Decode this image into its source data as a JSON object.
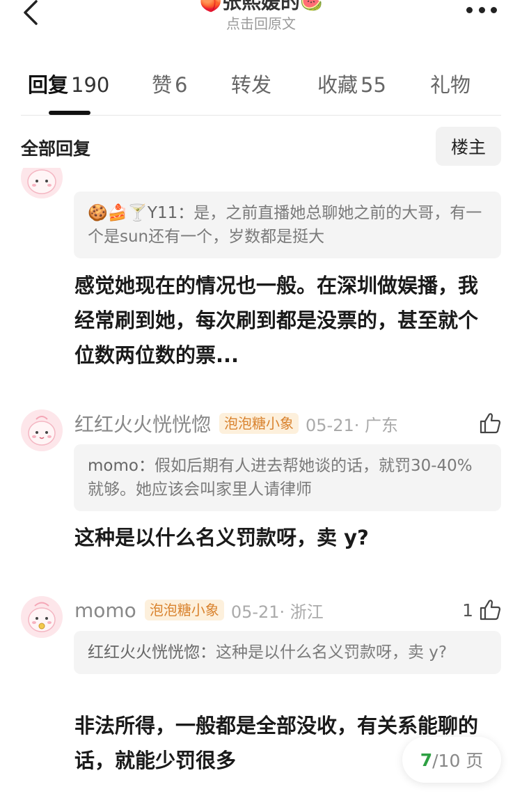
{
  "header": {
    "title_prefix_emoji": "🍑",
    "title": "张熙媛的",
    "title_suffix_emoji": "🍉",
    "subtitle": "点击回原文"
  },
  "tabs": [
    {
      "label": "回复",
      "count": "190",
      "active": true
    },
    {
      "label": "赞",
      "count": "6",
      "active": false
    },
    {
      "label": "转发",
      "count": "",
      "active": false
    },
    {
      "label": "收藏",
      "count": "55",
      "active": false
    },
    {
      "label": "礼物",
      "count": "",
      "active": false
    }
  ],
  "filter": {
    "label": "全部回复",
    "owner_button": "楼主"
  },
  "comments": [
    {
      "quote_name": "🍪🍰🍸Y11：",
      "quote_text": "是，之前直播她总聊她之前的大哥，有一个是sun还有一个，岁数都是挺大",
      "body": "感觉她现在的情况也一般。在深圳做娱播，我经常刷到她，每次刷到都是没票的，甚至就个位数两位数的票..."
    },
    {
      "name": "红红火火恍恍惚",
      "badge": "泡泡糖小象",
      "time": "05-21· 广东",
      "likes": "",
      "quote_name": "momo：",
      "quote_text": "假如后期有人进去帮她谈的话，就罚30-40%就够。她应该会叫家里人请律师",
      "body": "这种是以什么名义罚款呀，卖 y?"
    },
    {
      "name": "momo",
      "badge": "泡泡糖小象",
      "time": "05-21· 浙江",
      "likes": "1",
      "quote_name": "红红火火恍恍惚：",
      "quote_text": "这种是以什么名义罚款呀，卖 y?",
      "body": "非法所得，一般都是全部没收，有关系能聊的话，就能少罚很多"
    }
  ],
  "pager": {
    "current": "7",
    "total": "/10 页"
  }
}
